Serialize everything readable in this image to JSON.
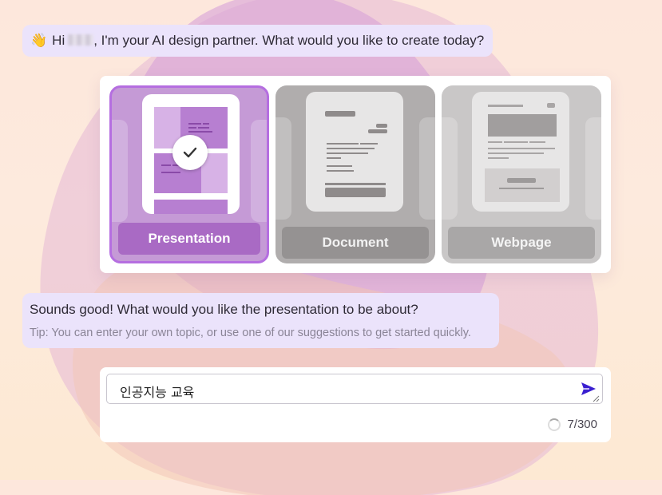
{
  "greeting": {
    "prefix": "Hi",
    "suffix": ", I'm your AI design partner. What would you like to create today?",
    "wave_icon": "waving-hand-icon"
  },
  "types": [
    {
      "label": "Presentation",
      "selected": true
    },
    {
      "label": "Document",
      "selected": false
    },
    {
      "label": "Webpage",
      "selected": false
    }
  ],
  "reply": {
    "question": "Sounds good! What would you like the presentation to be about?",
    "tip": "Tip: You can enter your own topic, or use one of our suggestions to get started quickly."
  },
  "topic_input": {
    "value": "인공지능 교육"
  },
  "counter": {
    "text": "7/300"
  },
  "colors": {
    "accent": "#b56ee0",
    "selected_card": "#c59ad6",
    "send": "#3a1fd0"
  }
}
